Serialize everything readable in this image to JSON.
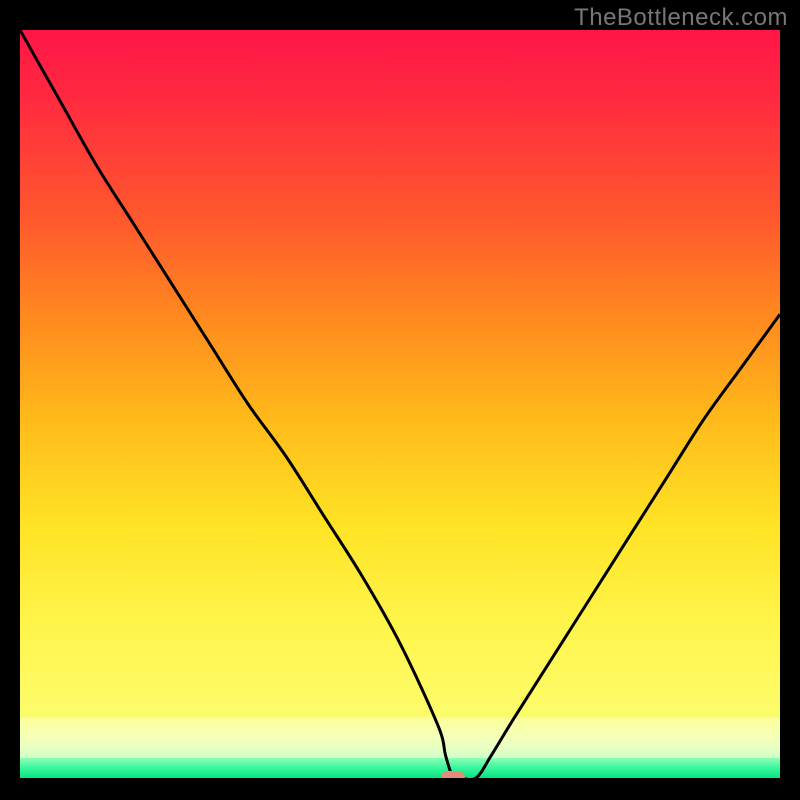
{
  "watermark": "TheBottleneck.com",
  "colors": {
    "frame": "#000000",
    "gradient_top": "#ff1547",
    "gradient_mid": "#ffe325",
    "gradient_pale": "#f6ffb6",
    "gradient_green": "#18ec8c",
    "curve": "#000000",
    "marker": "#e48b7a"
  },
  "chart_data": {
    "type": "line",
    "title": "",
    "xlabel": "",
    "ylabel": "",
    "xlim": [
      0,
      100
    ],
    "ylim": [
      0,
      100
    ],
    "x": [
      0,
      5,
      10,
      15,
      20,
      25,
      30,
      35,
      40,
      45,
      50,
      55,
      56,
      57,
      58,
      60,
      62,
      65,
      70,
      75,
      80,
      85,
      90,
      95,
      100
    ],
    "y": [
      100,
      91,
      82,
      74,
      66,
      58,
      50,
      43,
      35,
      27,
      18,
      7,
      3,
      0,
      0,
      0,
      3,
      8,
      16,
      24,
      32,
      40,
      48,
      55,
      62
    ],
    "marker": {
      "x": 57,
      "y": 0
    },
    "annotations": []
  }
}
